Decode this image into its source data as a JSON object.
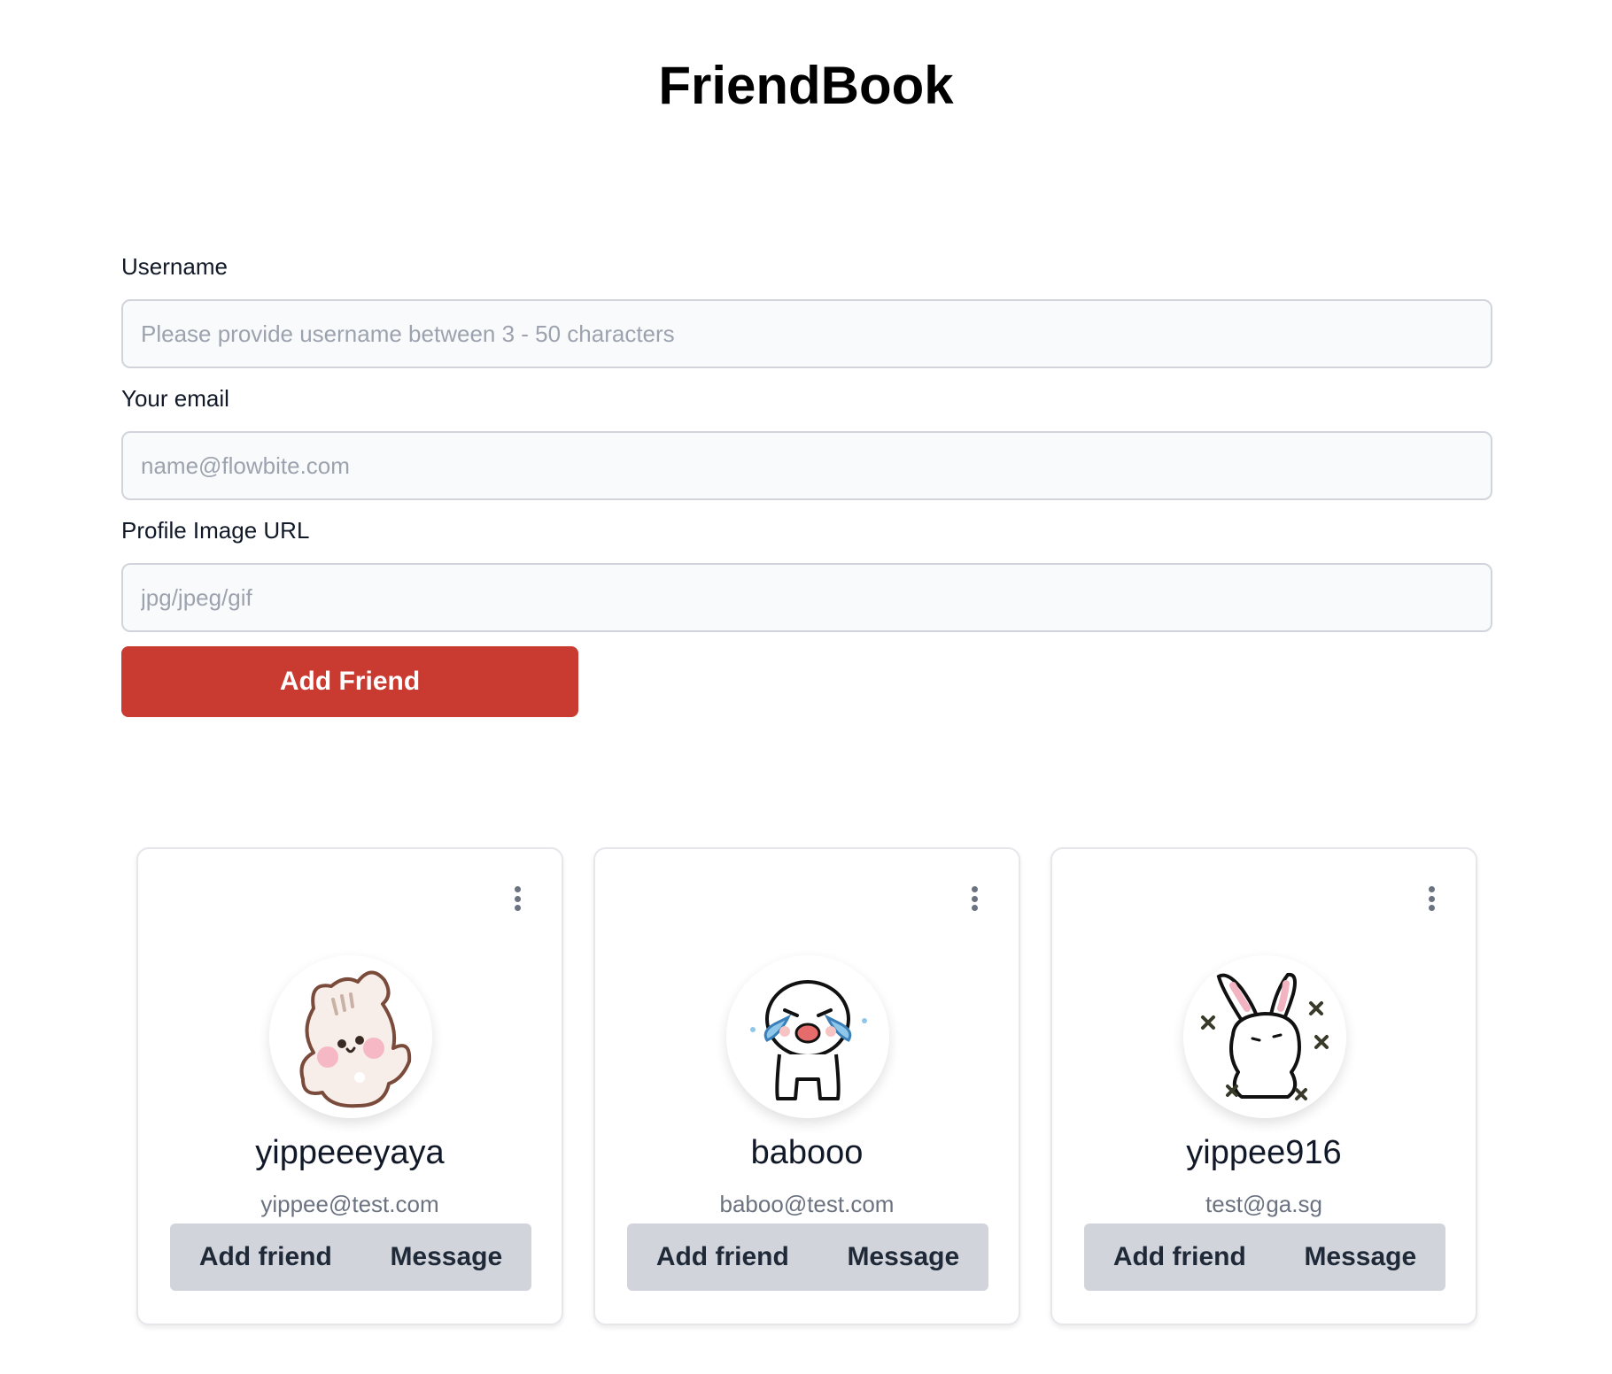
{
  "header": {
    "title": "FriendBook"
  },
  "form": {
    "username": {
      "label": "Username",
      "placeholder": "Please provide username between 3 - 50 characters",
      "value": ""
    },
    "email": {
      "label": "Your email",
      "placeholder": "name@flowbite.com",
      "value": ""
    },
    "image": {
      "label": "Profile Image URL",
      "placeholder": "jpg/jpeg/gif",
      "value": ""
    },
    "submit_label": "Add Friend"
  },
  "colors": {
    "primary": "#c93a31",
    "action_bg": "#d1d5db",
    "muted_text": "#6b7280"
  },
  "friends": [
    {
      "name": "yippeeeyaya",
      "email": "yippee@test.com",
      "avatar": "kitten-sticker",
      "add_label": "Add friend",
      "message_label": "Message",
      "menu_icon": "kebab-menu-icon"
    },
    {
      "name": "babooo",
      "email": "baboo@test.com",
      "avatar": "crying-character-sticker",
      "add_label": "Add friend",
      "message_label": "Message",
      "menu_icon": "kebab-menu-icon"
    },
    {
      "name": "yippee916",
      "email": "test@ga.sg",
      "avatar": "bunny-sticker",
      "add_label": "Add friend",
      "message_label": "Message",
      "menu_icon": "kebab-menu-icon"
    }
  ]
}
